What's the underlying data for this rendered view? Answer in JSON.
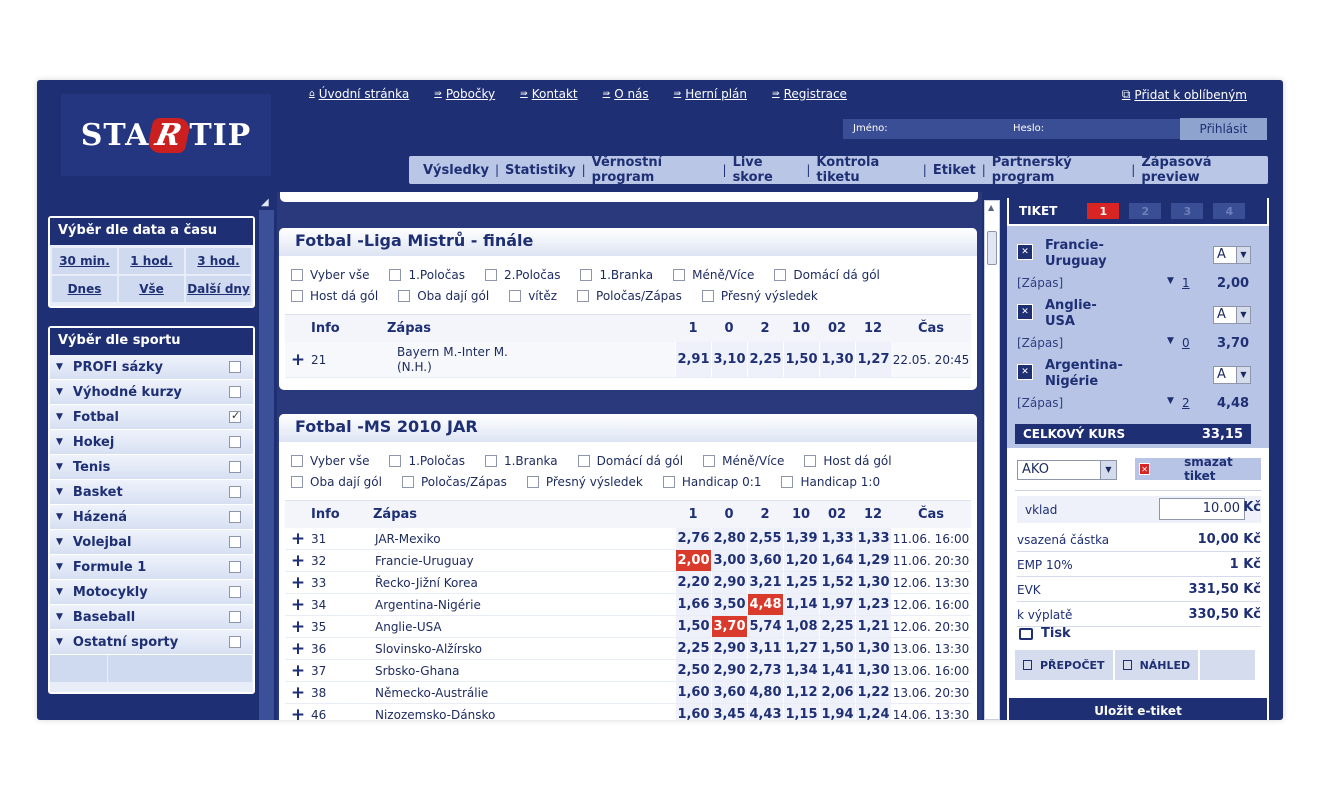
{
  "brand": {
    "logo_pre": "STA",
    "logo_r": "R",
    "logo_post": "TIP"
  },
  "topnav": [
    {
      "icon": "home-icon",
      "glyph": "⌂",
      "label": "Úvodní stránka"
    },
    {
      "icon": "arrow-icon",
      "glyph": "⇛",
      "label": "Pobočky"
    },
    {
      "icon": "arrow-icon",
      "glyph": "⇛",
      "label": "Kontakt"
    },
    {
      "icon": "arrow-icon",
      "glyph": "⇛",
      "label": "O nás"
    },
    {
      "icon": "arrow-icon",
      "glyph": "⇛",
      "label": "Herní plán"
    },
    {
      "icon": "arrow-icon",
      "glyph": "⇛",
      "label": "Registrace"
    }
  ],
  "favorites": {
    "label": "Přidat k oblíbeným"
  },
  "login": {
    "name_label": "Jméno:",
    "pass_label": "Heslo:",
    "button": "Přihlásit"
  },
  "mainnav": [
    "Výsledky",
    "Statistiky",
    "Věrnostní program",
    "Live skore",
    "Kontrola tiketu",
    "Etiket",
    "Partnerský program",
    "Zápasová preview"
  ],
  "time_panel": {
    "title": "Výběr dle data a času",
    "items": [
      "30 min.",
      "1 hod.",
      "3 hod.",
      "Dnes",
      "Vše",
      "Další dny"
    ]
  },
  "sport_panel": {
    "title": "Výběr dle sportu",
    "items": [
      {
        "label": "PROFI sázky",
        "checked": false
      },
      {
        "label": "Výhodné kurzy",
        "checked": false
      },
      {
        "label": "Fotbal",
        "checked": true
      },
      {
        "label": "Hokej",
        "checked": false
      },
      {
        "label": "Tenis",
        "checked": false
      },
      {
        "label": "Basket",
        "checked": false
      },
      {
        "label": "Házená",
        "checked": false
      },
      {
        "label": "Volejbal",
        "checked": false
      },
      {
        "label": "Formule 1",
        "checked": false
      },
      {
        "label": "Motocykly",
        "checked": false
      },
      {
        "label": "Baseball",
        "checked": false
      },
      {
        "label": "Ostatní sporty",
        "checked": false
      }
    ]
  },
  "leagues": [
    {
      "title": "Fotbal -Liga Mistrů - finále",
      "filters": [
        [
          "Vyber vše",
          "1.Poločas",
          "2.Poločas",
          "1.Branka",
          "Méně/Více",
          "Domácí dá gól"
        ],
        [
          "Host dá gól",
          "Oba dají gól",
          "vítěz",
          "Poločas/Zápas",
          "Přesný výsledek"
        ]
      ],
      "columns": {
        "info": "Info",
        "match": "Zápas",
        "odds": [
          "1",
          "0",
          "2",
          "10",
          "02",
          "12"
        ],
        "time": "Čas"
      },
      "rows": [
        {
          "info": "21",
          "match": "Bayern M.-Inter M.",
          "match2": "(N.H.)",
          "odds": [
            "2,91",
            "3,10",
            "2,25",
            "1,50",
            "1,30",
            "1,27"
          ],
          "selected": -1,
          "time": "22.05. 20:45"
        }
      ]
    },
    {
      "title": "Fotbal -MS 2010 JAR",
      "filters": [
        [
          "Vyber vše",
          "1.Poločas",
          "1.Branka",
          "Domácí dá gól",
          "Méně/Více",
          "Host dá gól"
        ],
        [
          "Oba dají gól",
          "Poločas/Zápas",
          "Přesný výsledek",
          "Handicap 0:1",
          "Handicap 1:0"
        ]
      ],
      "columns": {
        "info": "Info",
        "match": "Zápas",
        "odds": [
          "1",
          "0",
          "2",
          "10",
          "02",
          "12"
        ],
        "time": "Čas"
      },
      "rows": [
        {
          "info": "31",
          "match": "JAR-Mexiko",
          "odds": [
            "2,76",
            "2,80",
            "2,55",
            "1,39",
            "1,33",
            "1,33"
          ],
          "selected": -1,
          "time": "11.06. 16:00"
        },
        {
          "info": "32",
          "match": "Francie-Uruguay",
          "odds": [
            "2,00",
            "3,00",
            "3,60",
            "1,20",
            "1,64",
            "1,29"
          ],
          "selected": 0,
          "time": "11.06. 20:30"
        },
        {
          "info": "33",
          "match": "Řecko-Jižní Korea",
          "odds": [
            "2,20",
            "2,90",
            "3,21",
            "1,25",
            "1,52",
            "1,30"
          ],
          "selected": -1,
          "time": "12.06. 13:30"
        },
        {
          "info": "34",
          "match": "Argentina-Nigérie",
          "odds": [
            "1,66",
            "3,50",
            "4,48",
            "1,14",
            "1,97",
            "1,23"
          ],
          "selected": 2,
          "time": "12.06. 16:00"
        },
        {
          "info": "35",
          "match": "Anglie-USA",
          "odds": [
            "1,50",
            "3,70",
            "5,74",
            "1,08",
            "2,25",
            "1,21"
          ],
          "selected": 1,
          "time": "12.06. 20:30"
        },
        {
          "info": "36",
          "match": "Slovinsko-Alžírsko",
          "odds": [
            "2,25",
            "2,90",
            "3,11",
            "1,27",
            "1,50",
            "1,30"
          ],
          "selected": -1,
          "time": "13.06. 13:30"
        },
        {
          "info": "37",
          "match": "Srbsko-Ghana",
          "odds": [
            "2,50",
            "2,90",
            "2,73",
            "1,34",
            "1,41",
            "1,30"
          ],
          "selected": -1,
          "time": "13.06. 16:00"
        },
        {
          "info": "38",
          "match": "Německo-Austrálie",
          "odds": [
            "1,60",
            "3,60",
            "4,80",
            "1,12",
            "2,06",
            "1,22"
          ],
          "selected": -1,
          "time": "13.06. 20:30"
        },
        {
          "info": "46",
          "match": "Nizozemsko-Dánsko",
          "odds": [
            "1,60",
            "3,45",
            "4,43",
            "1,15",
            "1,94",
            "1,24"
          ],
          "selected": -1,
          "time": "14.06. 13:30"
        }
      ]
    }
  ],
  "ticket": {
    "title": "TIKET",
    "tabs": [
      "1",
      "2",
      "3",
      "4"
    ],
    "active_tab": 0,
    "bets": [
      {
        "line1": "Francie-",
        "line2": "Uruguay",
        "type": "[Zápas]",
        "sel": "A",
        "num": "1",
        "odd": "2,00"
      },
      {
        "line1": "Anglie-",
        "line2": "USA",
        "type": "[Zápas]",
        "sel": "A",
        "num": "0",
        "odd": "3,70"
      },
      {
        "line1": "Argentina-",
        "line2": "Nigérie",
        "type": "[Zápas]",
        "sel": "A",
        "num": "2",
        "odd": "4,48"
      }
    ],
    "total_label": "CELKOVÝ KURS",
    "total_value": "33,15",
    "bet_type": "AKO",
    "delete_label": "smazat tiket",
    "stake_label": "vklad",
    "stake_value": "10.00",
    "currency": "Kč",
    "summary": [
      {
        "label": "vsazená částka",
        "value": "10,00 Kč"
      },
      {
        "label": "EMP 10%",
        "value": "1 Kč"
      },
      {
        "label": "EVK",
        "value": "331,50 Kč"
      },
      {
        "label": "k výplatě",
        "value": "330,50 Kč"
      }
    ],
    "print_label": "Tisk",
    "recalc_label": "PŘEPOČET",
    "preview_label": "NÁHLED",
    "save_label": "Uložit e-tiket"
  }
}
